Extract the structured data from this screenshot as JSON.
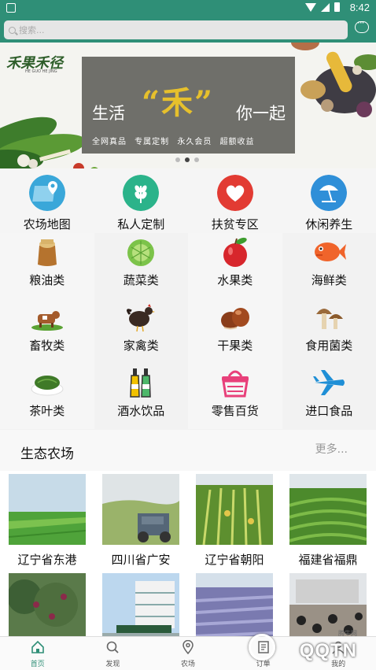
{
  "status_bar": {
    "time": "8:42"
  },
  "search": {
    "placeholder": "搜索..."
  },
  "banner": {
    "logo": "禾果禾径",
    "logo_sub": "HE GUO HE JING",
    "text_left": "生活",
    "text_mid": "“禾”",
    "text_right": "你一起",
    "subtitle": "全网真品 专属定制 永久会员 超额收益"
  },
  "top_nav": [
    {
      "label": "农场地图",
      "icon": "map-pin-icon",
      "color": "#3aa7d9"
    },
    {
      "label": "私人定制",
      "icon": "wheat-icon",
      "color": "#2bb38a"
    },
    {
      "label": "扶贫专区",
      "icon": "heart-icon",
      "color": "#e23b33"
    },
    {
      "label": "休闲养生",
      "icon": "umbrella-icon",
      "color": "#2f8fd8"
    }
  ],
  "categories": [
    {
      "label": "粮油类",
      "icon": "grain-sack-icon"
    },
    {
      "label": "蔬菜类",
      "icon": "cabbage-icon"
    },
    {
      "label": "水果类",
      "icon": "apple-icon"
    },
    {
      "label": "海鲜类",
      "icon": "fish-icon"
    },
    {
      "label": "畜牧类",
      "icon": "cow-icon"
    },
    {
      "label": "家禽类",
      "icon": "chicken-icon"
    },
    {
      "label": "干果类",
      "icon": "chestnut-icon"
    },
    {
      "label": "食用菌类",
      "icon": "mushroom-icon"
    },
    {
      "label": "茶叶类",
      "icon": "tea-leaf-icon"
    },
    {
      "label": "酒水饮品",
      "icon": "bottles-icon"
    },
    {
      "label": "零售百货",
      "icon": "basket-icon"
    },
    {
      "label": "进口食品",
      "icon": "airplane-icon"
    }
  ],
  "farm_section": {
    "title": "生态农场",
    "more": "更多...",
    "farms": [
      {
        "name": "辽宁省东港"
      },
      {
        "name": "四川省广安"
      },
      {
        "name": "辽宁省朝阳"
      },
      {
        "name": "福建省福鼎"
      }
    ]
  },
  "tabs": [
    {
      "label": "首页",
      "icon": "home-icon",
      "active": true
    },
    {
      "label": "发现",
      "icon": "search-icon",
      "active": false
    },
    {
      "label": "农场",
      "icon": "location-icon",
      "active": false
    },
    {
      "label": "订单",
      "icon": "order-icon",
      "active": false
    },
    {
      "label": "我的",
      "icon": "user-icon",
      "active": false
    }
  ],
  "watermark": {
    "text": "QQTN",
    "small": "腾牛网"
  },
  "colors": {
    "brand": "#2f8f77",
    "accent": "#e6c02c"
  }
}
